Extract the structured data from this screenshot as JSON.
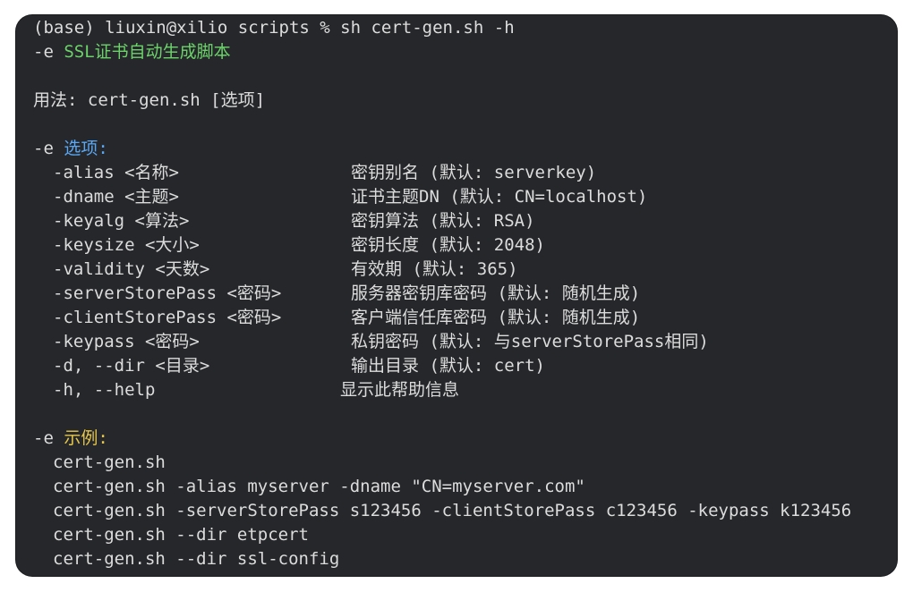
{
  "terminal": {
    "prompt": "(base) liuxin@xilio scripts % sh cert-gen.sh -h",
    "title_prefix": "-e ",
    "title": "SSL证书自动生成脚本",
    "usage": "用法: cert-gen.sh [选项]",
    "options_prefix": "-e ",
    "options_heading": "选项:",
    "options": [
      {
        "flag": "-alias <名称>",
        "desc": "密钥别名 (默认: serverkey)"
      },
      {
        "flag": "-dname <主题>",
        "desc": "证书主题DN (默认: CN=localhost)"
      },
      {
        "flag": "-keyalg <算法>",
        "desc": "密钥算法 (默认: RSA)"
      },
      {
        "flag": "-keysize <大小>",
        "desc": "密钥长度 (默认: 2048)"
      },
      {
        "flag": "-validity <天数>",
        "desc": "有效期 (默认: 365)"
      },
      {
        "flag": "-serverStorePass <密码>",
        "desc": "服务器密钥库密码 (默认: 随机生成)"
      },
      {
        "flag": "-clientStorePass <密码>",
        "desc": "客户端信任库密码 (默认: 随机生成)"
      },
      {
        "flag": "-keypass <密码>",
        "desc": "私钥密码 (默认: 与serverStorePass相同)"
      },
      {
        "flag": "-d, --dir <目录>",
        "desc": "输出目录 (默认: cert)"
      },
      {
        "flag": "-h, --help",
        "desc": "显示此帮助信息"
      }
    ],
    "examples_prefix": "-e ",
    "examples_heading": "示例:",
    "examples": [
      "cert-gen.sh",
      "cert-gen.sh -alias myserver -dname \"CN=myserver.com\"",
      "cert-gen.sh -serverStorePass s123456 -clientStorePass c123456 -keypass k123456",
      "cert-gen.sh --dir etpcert",
      "cert-gen.sh --dir ssl-config"
    ]
  },
  "colors": {
    "background": "#25272a",
    "text": "#dcdcdc",
    "title": "#6cd36a",
    "options_heading": "#5aa8f5",
    "examples_heading": "#e6c74c"
  }
}
